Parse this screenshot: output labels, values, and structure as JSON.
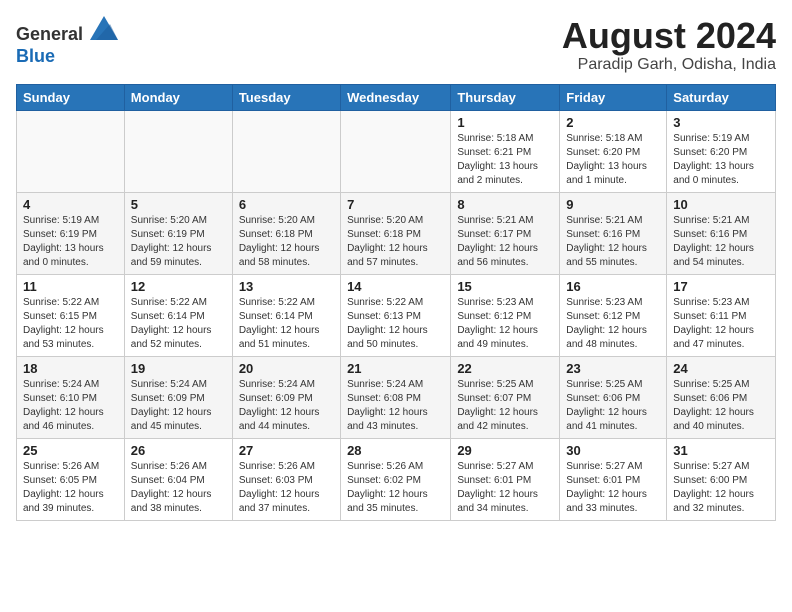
{
  "header": {
    "logo_line1": "General",
    "logo_line2": "Blue",
    "title": "August 2024",
    "subtitle": "Paradip Garh, Odisha, India"
  },
  "days_of_week": [
    "Sunday",
    "Monday",
    "Tuesday",
    "Wednesday",
    "Thursday",
    "Friday",
    "Saturday"
  ],
  "weeks": [
    [
      {
        "day": "",
        "info": ""
      },
      {
        "day": "",
        "info": ""
      },
      {
        "day": "",
        "info": ""
      },
      {
        "day": "",
        "info": ""
      },
      {
        "day": "1",
        "info": "Sunrise: 5:18 AM\nSunset: 6:21 PM\nDaylight: 13 hours\nand 2 minutes."
      },
      {
        "day": "2",
        "info": "Sunrise: 5:18 AM\nSunset: 6:20 PM\nDaylight: 13 hours\nand 1 minute."
      },
      {
        "day": "3",
        "info": "Sunrise: 5:19 AM\nSunset: 6:20 PM\nDaylight: 13 hours\nand 0 minutes."
      }
    ],
    [
      {
        "day": "4",
        "info": "Sunrise: 5:19 AM\nSunset: 6:19 PM\nDaylight: 13 hours\nand 0 minutes."
      },
      {
        "day": "5",
        "info": "Sunrise: 5:20 AM\nSunset: 6:19 PM\nDaylight: 12 hours\nand 59 minutes."
      },
      {
        "day": "6",
        "info": "Sunrise: 5:20 AM\nSunset: 6:18 PM\nDaylight: 12 hours\nand 58 minutes."
      },
      {
        "day": "7",
        "info": "Sunrise: 5:20 AM\nSunset: 6:18 PM\nDaylight: 12 hours\nand 57 minutes."
      },
      {
        "day": "8",
        "info": "Sunrise: 5:21 AM\nSunset: 6:17 PM\nDaylight: 12 hours\nand 56 minutes."
      },
      {
        "day": "9",
        "info": "Sunrise: 5:21 AM\nSunset: 6:16 PM\nDaylight: 12 hours\nand 55 minutes."
      },
      {
        "day": "10",
        "info": "Sunrise: 5:21 AM\nSunset: 6:16 PM\nDaylight: 12 hours\nand 54 minutes."
      }
    ],
    [
      {
        "day": "11",
        "info": "Sunrise: 5:22 AM\nSunset: 6:15 PM\nDaylight: 12 hours\nand 53 minutes."
      },
      {
        "day": "12",
        "info": "Sunrise: 5:22 AM\nSunset: 6:14 PM\nDaylight: 12 hours\nand 52 minutes."
      },
      {
        "day": "13",
        "info": "Sunrise: 5:22 AM\nSunset: 6:14 PM\nDaylight: 12 hours\nand 51 minutes."
      },
      {
        "day": "14",
        "info": "Sunrise: 5:22 AM\nSunset: 6:13 PM\nDaylight: 12 hours\nand 50 minutes."
      },
      {
        "day": "15",
        "info": "Sunrise: 5:23 AM\nSunset: 6:12 PM\nDaylight: 12 hours\nand 49 minutes."
      },
      {
        "day": "16",
        "info": "Sunrise: 5:23 AM\nSunset: 6:12 PM\nDaylight: 12 hours\nand 48 minutes."
      },
      {
        "day": "17",
        "info": "Sunrise: 5:23 AM\nSunset: 6:11 PM\nDaylight: 12 hours\nand 47 minutes."
      }
    ],
    [
      {
        "day": "18",
        "info": "Sunrise: 5:24 AM\nSunset: 6:10 PM\nDaylight: 12 hours\nand 46 minutes."
      },
      {
        "day": "19",
        "info": "Sunrise: 5:24 AM\nSunset: 6:09 PM\nDaylight: 12 hours\nand 45 minutes."
      },
      {
        "day": "20",
        "info": "Sunrise: 5:24 AM\nSunset: 6:09 PM\nDaylight: 12 hours\nand 44 minutes."
      },
      {
        "day": "21",
        "info": "Sunrise: 5:24 AM\nSunset: 6:08 PM\nDaylight: 12 hours\nand 43 minutes."
      },
      {
        "day": "22",
        "info": "Sunrise: 5:25 AM\nSunset: 6:07 PM\nDaylight: 12 hours\nand 42 minutes."
      },
      {
        "day": "23",
        "info": "Sunrise: 5:25 AM\nSunset: 6:06 PM\nDaylight: 12 hours\nand 41 minutes."
      },
      {
        "day": "24",
        "info": "Sunrise: 5:25 AM\nSunset: 6:06 PM\nDaylight: 12 hours\nand 40 minutes."
      }
    ],
    [
      {
        "day": "25",
        "info": "Sunrise: 5:26 AM\nSunset: 6:05 PM\nDaylight: 12 hours\nand 39 minutes."
      },
      {
        "day": "26",
        "info": "Sunrise: 5:26 AM\nSunset: 6:04 PM\nDaylight: 12 hours\nand 38 minutes."
      },
      {
        "day": "27",
        "info": "Sunrise: 5:26 AM\nSunset: 6:03 PM\nDaylight: 12 hours\nand 37 minutes."
      },
      {
        "day": "28",
        "info": "Sunrise: 5:26 AM\nSunset: 6:02 PM\nDaylight: 12 hours\nand 35 minutes."
      },
      {
        "day": "29",
        "info": "Sunrise: 5:27 AM\nSunset: 6:01 PM\nDaylight: 12 hours\nand 34 minutes."
      },
      {
        "day": "30",
        "info": "Sunrise: 5:27 AM\nSunset: 6:01 PM\nDaylight: 12 hours\nand 33 minutes."
      },
      {
        "day": "31",
        "info": "Sunrise: 5:27 AM\nSunset: 6:00 PM\nDaylight: 12 hours\nand 32 minutes."
      }
    ]
  ]
}
